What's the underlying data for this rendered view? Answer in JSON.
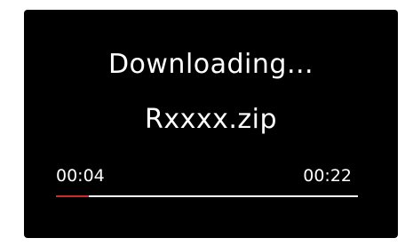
{
  "download": {
    "status": "Downloading...",
    "filename": "Rxxxx.zip",
    "elapsed": "00:04",
    "total": "00:22",
    "progress": 0.11
  },
  "colors": {
    "background": "#000000",
    "text": "#ffffff",
    "track": "#ffffff",
    "progress": "#cc2b2b"
  }
}
